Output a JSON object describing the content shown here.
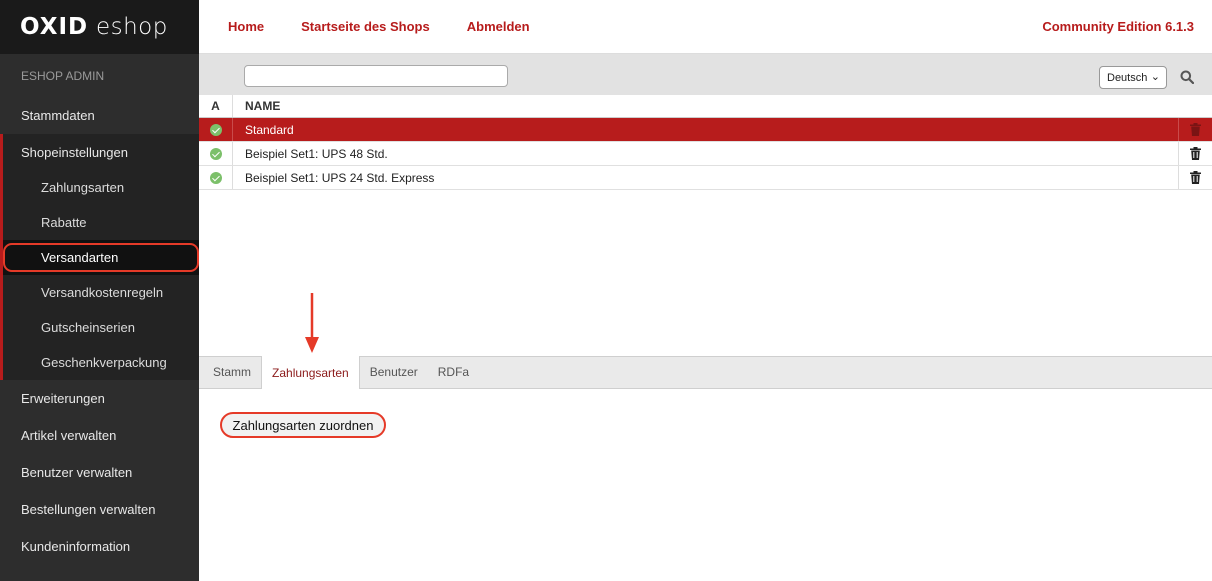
{
  "logo": {
    "brand": "OXID",
    "product": "eshop"
  },
  "sidebar": {
    "header": "ESHOP ADMIN",
    "top_item": "Stammdaten",
    "group": {
      "label": "Shopeinstellungen",
      "items": [
        "Zahlungsarten",
        "Rabatte",
        "Versandarten",
        "Versandkostenregeln",
        "Gutscheinserien",
        "Geschenkverpackung"
      ],
      "active_index": 2
    },
    "bottom_items": [
      "Erweiterungen",
      "Artikel verwalten",
      "Benutzer verwalten",
      "Bestellungen verwalten",
      "Kundeninformation"
    ]
  },
  "topbar": {
    "links": [
      "Home",
      "Startseite des Shops",
      "Abmelden"
    ],
    "edition": "Community Edition 6.1.3"
  },
  "filter": {
    "value": "",
    "language": "Deutsch"
  },
  "table": {
    "columns": {
      "active": "A",
      "name": "NAME"
    },
    "rows": [
      {
        "name": "Standard",
        "selected": true
      },
      {
        "name": "Beispiel Set1: UPS 48 Std.",
        "selected": false
      },
      {
        "name": "Beispiel Set1: UPS 24 Std. Express",
        "selected": false
      }
    ]
  },
  "tabs": [
    "Stamm",
    "Zahlungsarten",
    "Benutzer",
    "RDFa"
  ],
  "active_tab_index": 1,
  "content": {
    "assign_button": "Zahlungsarten zuordnen"
  },
  "colors": {
    "accent": "#b71c1c",
    "highlight": "#e53a28",
    "sidebar": "#2d2d2d"
  }
}
